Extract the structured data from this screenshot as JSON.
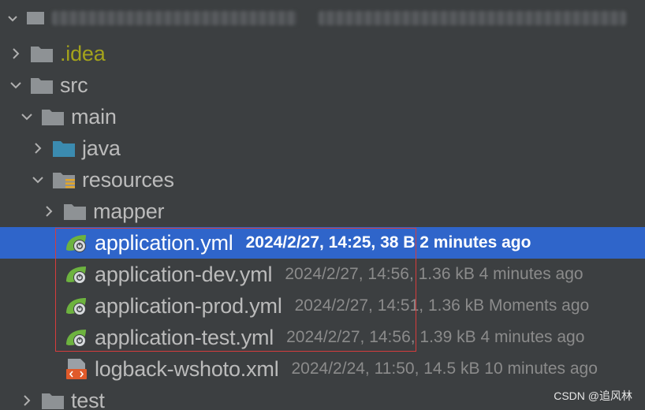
{
  "tree": {
    "items": [
      {
        "label": ".idea"
      },
      {
        "label": "src"
      },
      {
        "label": "main"
      },
      {
        "label": "java"
      },
      {
        "label": "resources"
      },
      {
        "label": "mapper"
      },
      {
        "label": "application.yml",
        "meta": "2024/2/27, 14:25, 38 B 2 minutes ago",
        "selected": true
      },
      {
        "label": "application-dev.yml",
        "meta": "2024/2/27, 14:56, 1.36 kB 4 minutes ago"
      },
      {
        "label": "application-prod.yml",
        "meta": "2024/2/27, 14:51, 1.36 kB Moments ago"
      },
      {
        "label": "application-test.yml",
        "meta": "2024/2/27, 14:56, 1.39 kB 4 minutes ago"
      },
      {
        "label": "logback-wshoto.xml",
        "meta": "2024/2/24, 11:50, 14.5 kB 10 minutes ago"
      },
      {
        "label": "test"
      }
    ]
  },
  "watermark": "CSDN @追风林",
  "colors": {
    "background": "#3c3f41",
    "selection": "#2f65ca",
    "highlight_box": "#d63c3c",
    "idea_label": "#a4a31b"
  }
}
